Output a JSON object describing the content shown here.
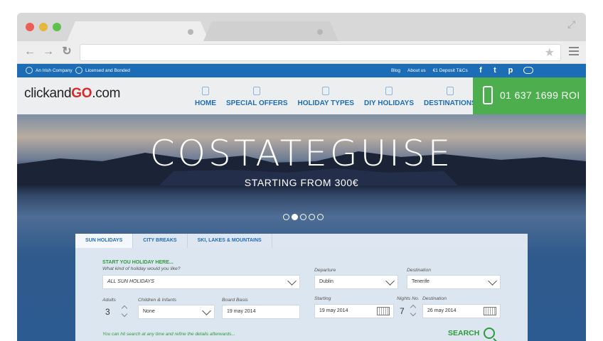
{
  "browser": {
    "address": "",
    "controls": {
      "back": "←",
      "forward": "→",
      "reload": "↻",
      "star": "★",
      "resize": "⤢"
    }
  },
  "site": {
    "topbar": {
      "badges": [
        "An Irish Company",
        "Licensed and Bonded"
      ],
      "links": [
        "Blog",
        "About us",
        "€1 Deposit T&Cs"
      ],
      "social": [
        "facebook-icon",
        "twitter-icon",
        "pinterest-icon",
        "chat-icon"
      ]
    },
    "logo": {
      "prefix": "clickand",
      "go": "GO",
      "suffix": ".com"
    },
    "nav": [
      {
        "label": "HOME",
        "icon": "home-icon"
      },
      {
        "label": "SPECIAL OFFERS",
        "icon": "bookmark-icon"
      },
      {
        "label": "HOLIDAY TYPES",
        "icon": "card-icon"
      },
      {
        "label": "DIY HOLIDAYS",
        "icon": "pencil-icon"
      },
      {
        "label": "DESTINATIONS",
        "icon": "map-pin-icon"
      }
    ],
    "phone": "01 637 1699 ROI",
    "hero": {
      "title": "COSTATEGUISE",
      "subtitle": "STARTING FROM 300€",
      "slides": 5,
      "active_slide": 2
    },
    "search": {
      "tabs": [
        "SUN HOLIDAYS",
        "CITY BREAKS",
        "SKI, LAKES & MOUNTAINS"
      ],
      "heading": "START YOU HOLIDAY HERE...",
      "question": "What kind of holiday would you like?",
      "holiday_type": "ALL SUN HOLIDAYS",
      "departure_label": "Departure",
      "departure": "Dublin",
      "destination_label": "Destination",
      "destination": "Tenerife",
      "adults_label": "Adults",
      "adults": "3",
      "children_label": "Children & Infants",
      "children": "None",
      "board_label": "Board Basis",
      "board": "19 may 2014",
      "starting_label": "Starting",
      "starting": "19 may 2014",
      "nights_label": "Nights No.",
      "nights": "7",
      "destination2_label": "Destination",
      "destination2": "26 may 2014",
      "hint": "You can hit search at any time and refine the details afterwards...",
      "search_label": "SEARCH"
    }
  }
}
